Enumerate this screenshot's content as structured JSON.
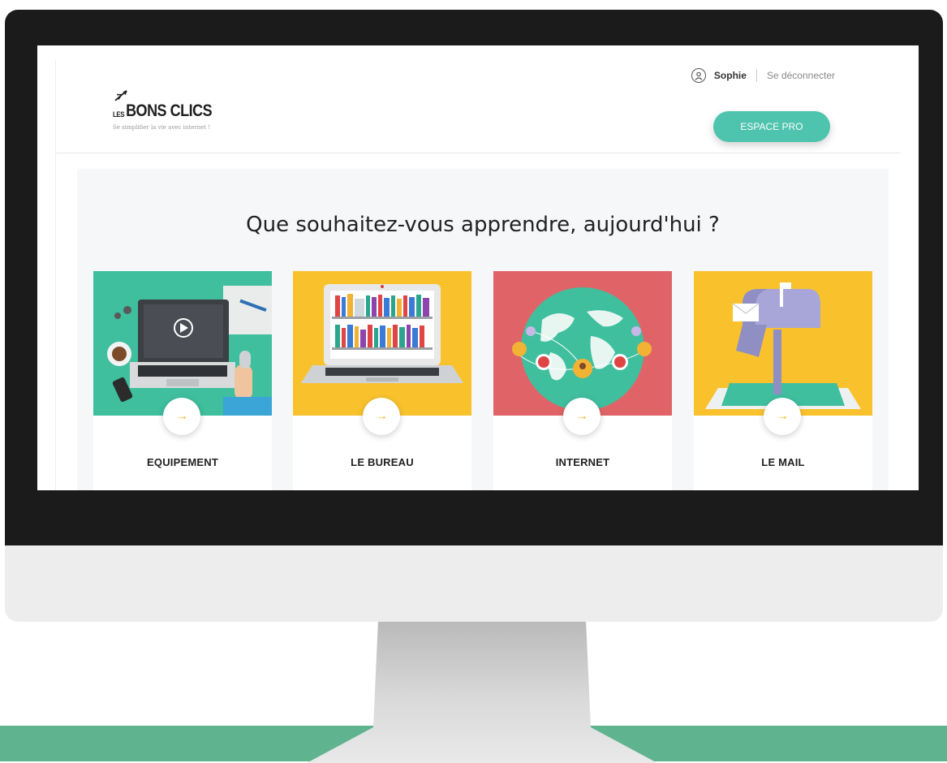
{
  "header": {
    "user_name": "Sophie",
    "logout_label": "Se déconnecter",
    "logo_les": "LES",
    "logo_main": "BONS CLICS",
    "logo_tagline": "Se simplifier la vie avec internet !",
    "espace_pro_label": "ESPACE PRO"
  },
  "main": {
    "headline": "Que souhaitez-vous apprendre, aujourd'hui ?",
    "cards": [
      {
        "label": "EQUIPEMENT",
        "bg": "#3fbf9e",
        "icon": "laptop-desk-icon"
      },
      {
        "label": "LE BUREAU",
        "bg": "#f9c22d",
        "icon": "laptop-bookshelf-icon"
      },
      {
        "label": "INTERNET",
        "bg": "#e06467",
        "icon": "globe-network-icon"
      },
      {
        "label": "LE MAIL",
        "bg": "#f9c22d",
        "icon": "mailbox-icon"
      }
    ],
    "arrow_glyph": "→"
  },
  "colors": {
    "accent": "#4ec3ad",
    "arrow": "#f5b820",
    "bezel": "#1b1b1b",
    "floor": "#5fb38f"
  }
}
